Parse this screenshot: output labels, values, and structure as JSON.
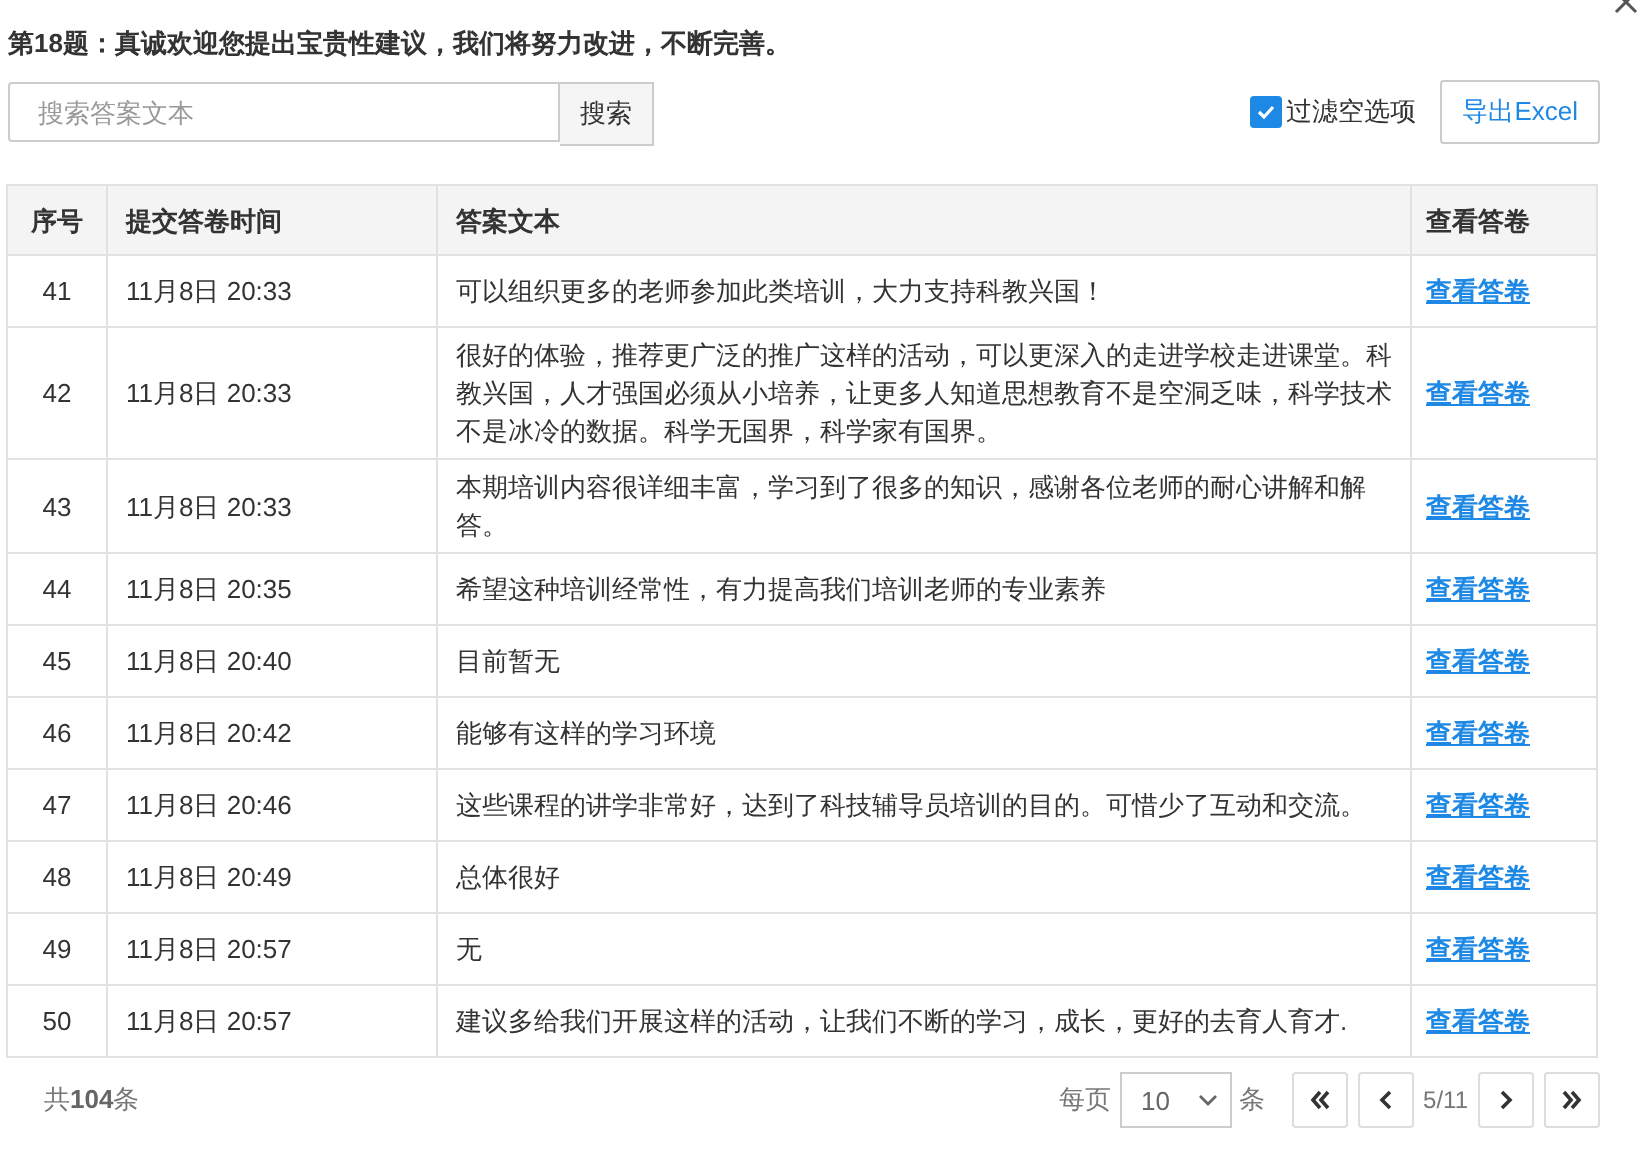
{
  "question": "第18题：真诚欢迎您提出宝贵性建议，我们将努力改进，不断完善。",
  "search": {
    "placeholder": "搜索答案文本",
    "button": "搜索"
  },
  "filter": {
    "label": "过滤空选项",
    "checked": true
  },
  "export_button": "导出Excel",
  "table": {
    "columns": [
      "序号",
      "提交答卷时间",
      "答案文本",
      "查看答卷"
    ],
    "rows": [
      {
        "no": "41",
        "time": "11月8日 20:33",
        "text": "可以组织更多的老师参加此类培训，大力支持科教兴国！",
        "link": "查看答卷"
      },
      {
        "no": "42",
        "time": "11月8日 20:33",
        "text": "很好的体验，推荐更广泛的推广这样的活动，可以更深入的走进学校走进课堂。科教兴国，人才强国必须从小培养，让更多人知道思想教育不是空洞乏味，科学技术不是冰冷的数据。科学无国界，科学家有国界。",
        "link": "查看答卷"
      },
      {
        "no": "43",
        "time": "11月8日 20:33",
        "text": "本期培训内容很详细丰富，学习到了很多的知识，感谢各位老师的耐心讲解和解答。",
        "link": "查看答卷"
      },
      {
        "no": "44",
        "time": "11月8日 20:35",
        "text": "希望这种培训经常性，有力提高我们培训老师的专业素养",
        "link": "查看答卷"
      },
      {
        "no": "45",
        "time": "11月8日 20:40",
        "text": "目前暂无",
        "link": "查看答卷"
      },
      {
        "no": "46",
        "time": "11月8日 20:42",
        "text": "能够有这样的学习环境",
        "link": "查看答卷"
      },
      {
        "no": "47",
        "time": "11月8日 20:46",
        "text": "这些课程的讲学非常好，达到了科技辅导员培训的目的。可惜少了互动和交流。",
        "link": "查看答卷"
      },
      {
        "no": "48",
        "time": "11月8日 20:49",
        "text": "总体很好",
        "link": "查看答卷"
      },
      {
        "no": "49",
        "time": "11月8日 20:57",
        "text": "无",
        "link": "查看答卷"
      },
      {
        "no": "50",
        "time": "11月8日 20:57",
        "text": "建议多给我们开展这样的活动，让我们不断的学习，成长，更好的去育人育才.",
        "link": "查看答卷"
      }
    ]
  },
  "pagination": {
    "total": "共**104**条",
    "per_page_label": "每页",
    "per_page": "10",
    "unit": "条",
    "page": "5/11"
  }
}
